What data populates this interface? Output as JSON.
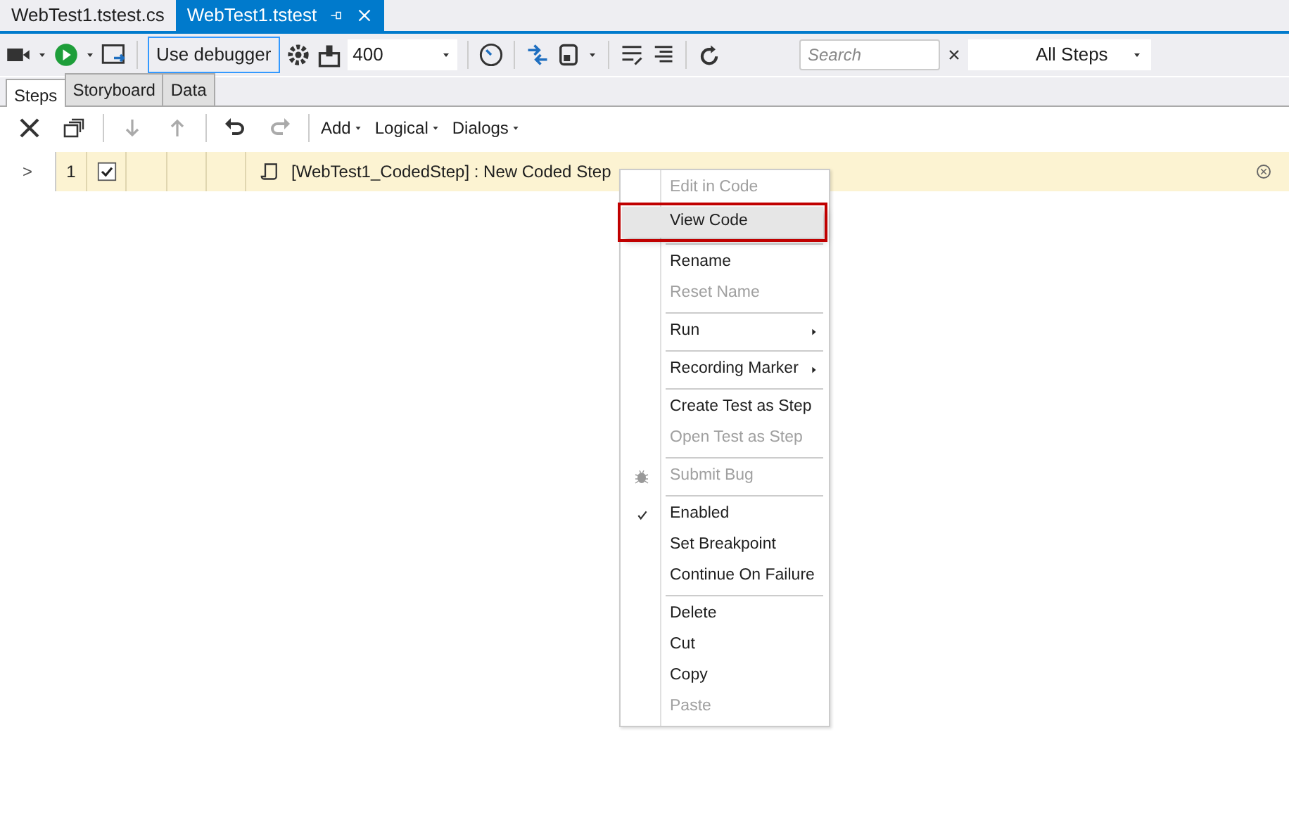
{
  "doc_tabs": [
    {
      "label": "WebTest1.tstest.cs",
      "selected": false
    },
    {
      "label": "WebTest1.tstest",
      "selected": true
    }
  ],
  "toolbar": {
    "debugger_button": {
      "label": "Use debugger",
      "on": true
    },
    "delay": {
      "value": "400"
    },
    "search": {
      "placeholder": "Search"
    },
    "filter": {
      "value": "All Steps"
    }
  },
  "view_tabs": [
    {
      "label": "Steps",
      "selected": true
    },
    {
      "label": "Storyboard",
      "selected": false
    },
    {
      "label": "Data",
      "selected": false
    }
  ],
  "step_toolbar": {
    "buttons": [
      {
        "kind": "delete",
        "disabled": false
      },
      {
        "kind": "copy",
        "disabled": false
      },
      {
        "kind": "down",
        "disabled": true
      },
      {
        "kind": "up",
        "disabled": true
      },
      {
        "kind": "undo",
        "disabled": false
      },
      {
        "kind": "redo",
        "disabled": true
      }
    ],
    "menus": [
      "Add",
      "Logical",
      "Dialogs"
    ]
  },
  "steps": [
    {
      "expander": ">",
      "number": "1",
      "checked": true,
      "description": "[WebTest1_CodedStep] : New Coded Step"
    }
  ],
  "context_menu": [
    {
      "kind": "item",
      "label": "Edit in Code",
      "disabled": true,
      "selected": false,
      "checked": false,
      "submenu": false
    },
    {
      "kind": "item",
      "label": "View Code",
      "disabled": false,
      "selected": true,
      "checked": false,
      "submenu": false
    },
    {
      "kind": "separator"
    },
    {
      "kind": "item",
      "label": "Rename",
      "disabled": false,
      "selected": false,
      "checked": false,
      "submenu": false
    },
    {
      "kind": "item",
      "label": "Reset Name",
      "disabled": true,
      "selected": false,
      "checked": false,
      "submenu": false
    },
    {
      "kind": "separator"
    },
    {
      "kind": "item",
      "label": "Run",
      "disabled": false,
      "selected": false,
      "checked": false,
      "submenu": true
    },
    {
      "kind": "separator"
    },
    {
      "kind": "item",
      "label": "Recording Marker",
      "disabled": false,
      "selected": false,
      "checked": false,
      "submenu": true
    },
    {
      "kind": "separator"
    },
    {
      "kind": "item",
      "label": "Create Test as Step",
      "disabled": false,
      "selected": false,
      "checked": false,
      "submenu": false
    },
    {
      "kind": "item",
      "label": "Open Test as Step",
      "disabled": true,
      "selected": false,
      "checked": false,
      "submenu": false
    },
    {
      "kind": "separator"
    },
    {
      "kind": "bug",
      "label": "Submit Bug",
      "disabled": true,
      "selected": false,
      "checked": false,
      "submenu": false
    },
    {
      "kind": "separator"
    },
    {
      "kind": "item",
      "label": "Enabled",
      "disabled": false,
      "selected": false,
      "checked": true,
      "submenu": false
    },
    {
      "kind": "item",
      "label": "Set Breakpoint",
      "disabled": false,
      "selected": false,
      "checked": false,
      "submenu": false
    },
    {
      "kind": "item",
      "label": "Continue On Failure",
      "disabled": false,
      "selected": false,
      "checked": false,
      "submenu": false
    },
    {
      "kind": "separator"
    },
    {
      "kind": "item",
      "label": "Delete",
      "disabled": false,
      "selected": false,
      "checked": false,
      "submenu": false
    },
    {
      "kind": "item",
      "label": "Cut",
      "disabled": false,
      "selected": false,
      "checked": false,
      "submenu": false
    },
    {
      "kind": "item",
      "label": "Copy",
      "disabled": false,
      "selected": false,
      "checked": false,
      "submenu": false
    },
    {
      "kind": "item",
      "label": "Paste",
      "disabled": true,
      "selected": false,
      "checked": false,
      "submenu": false
    }
  ]
}
